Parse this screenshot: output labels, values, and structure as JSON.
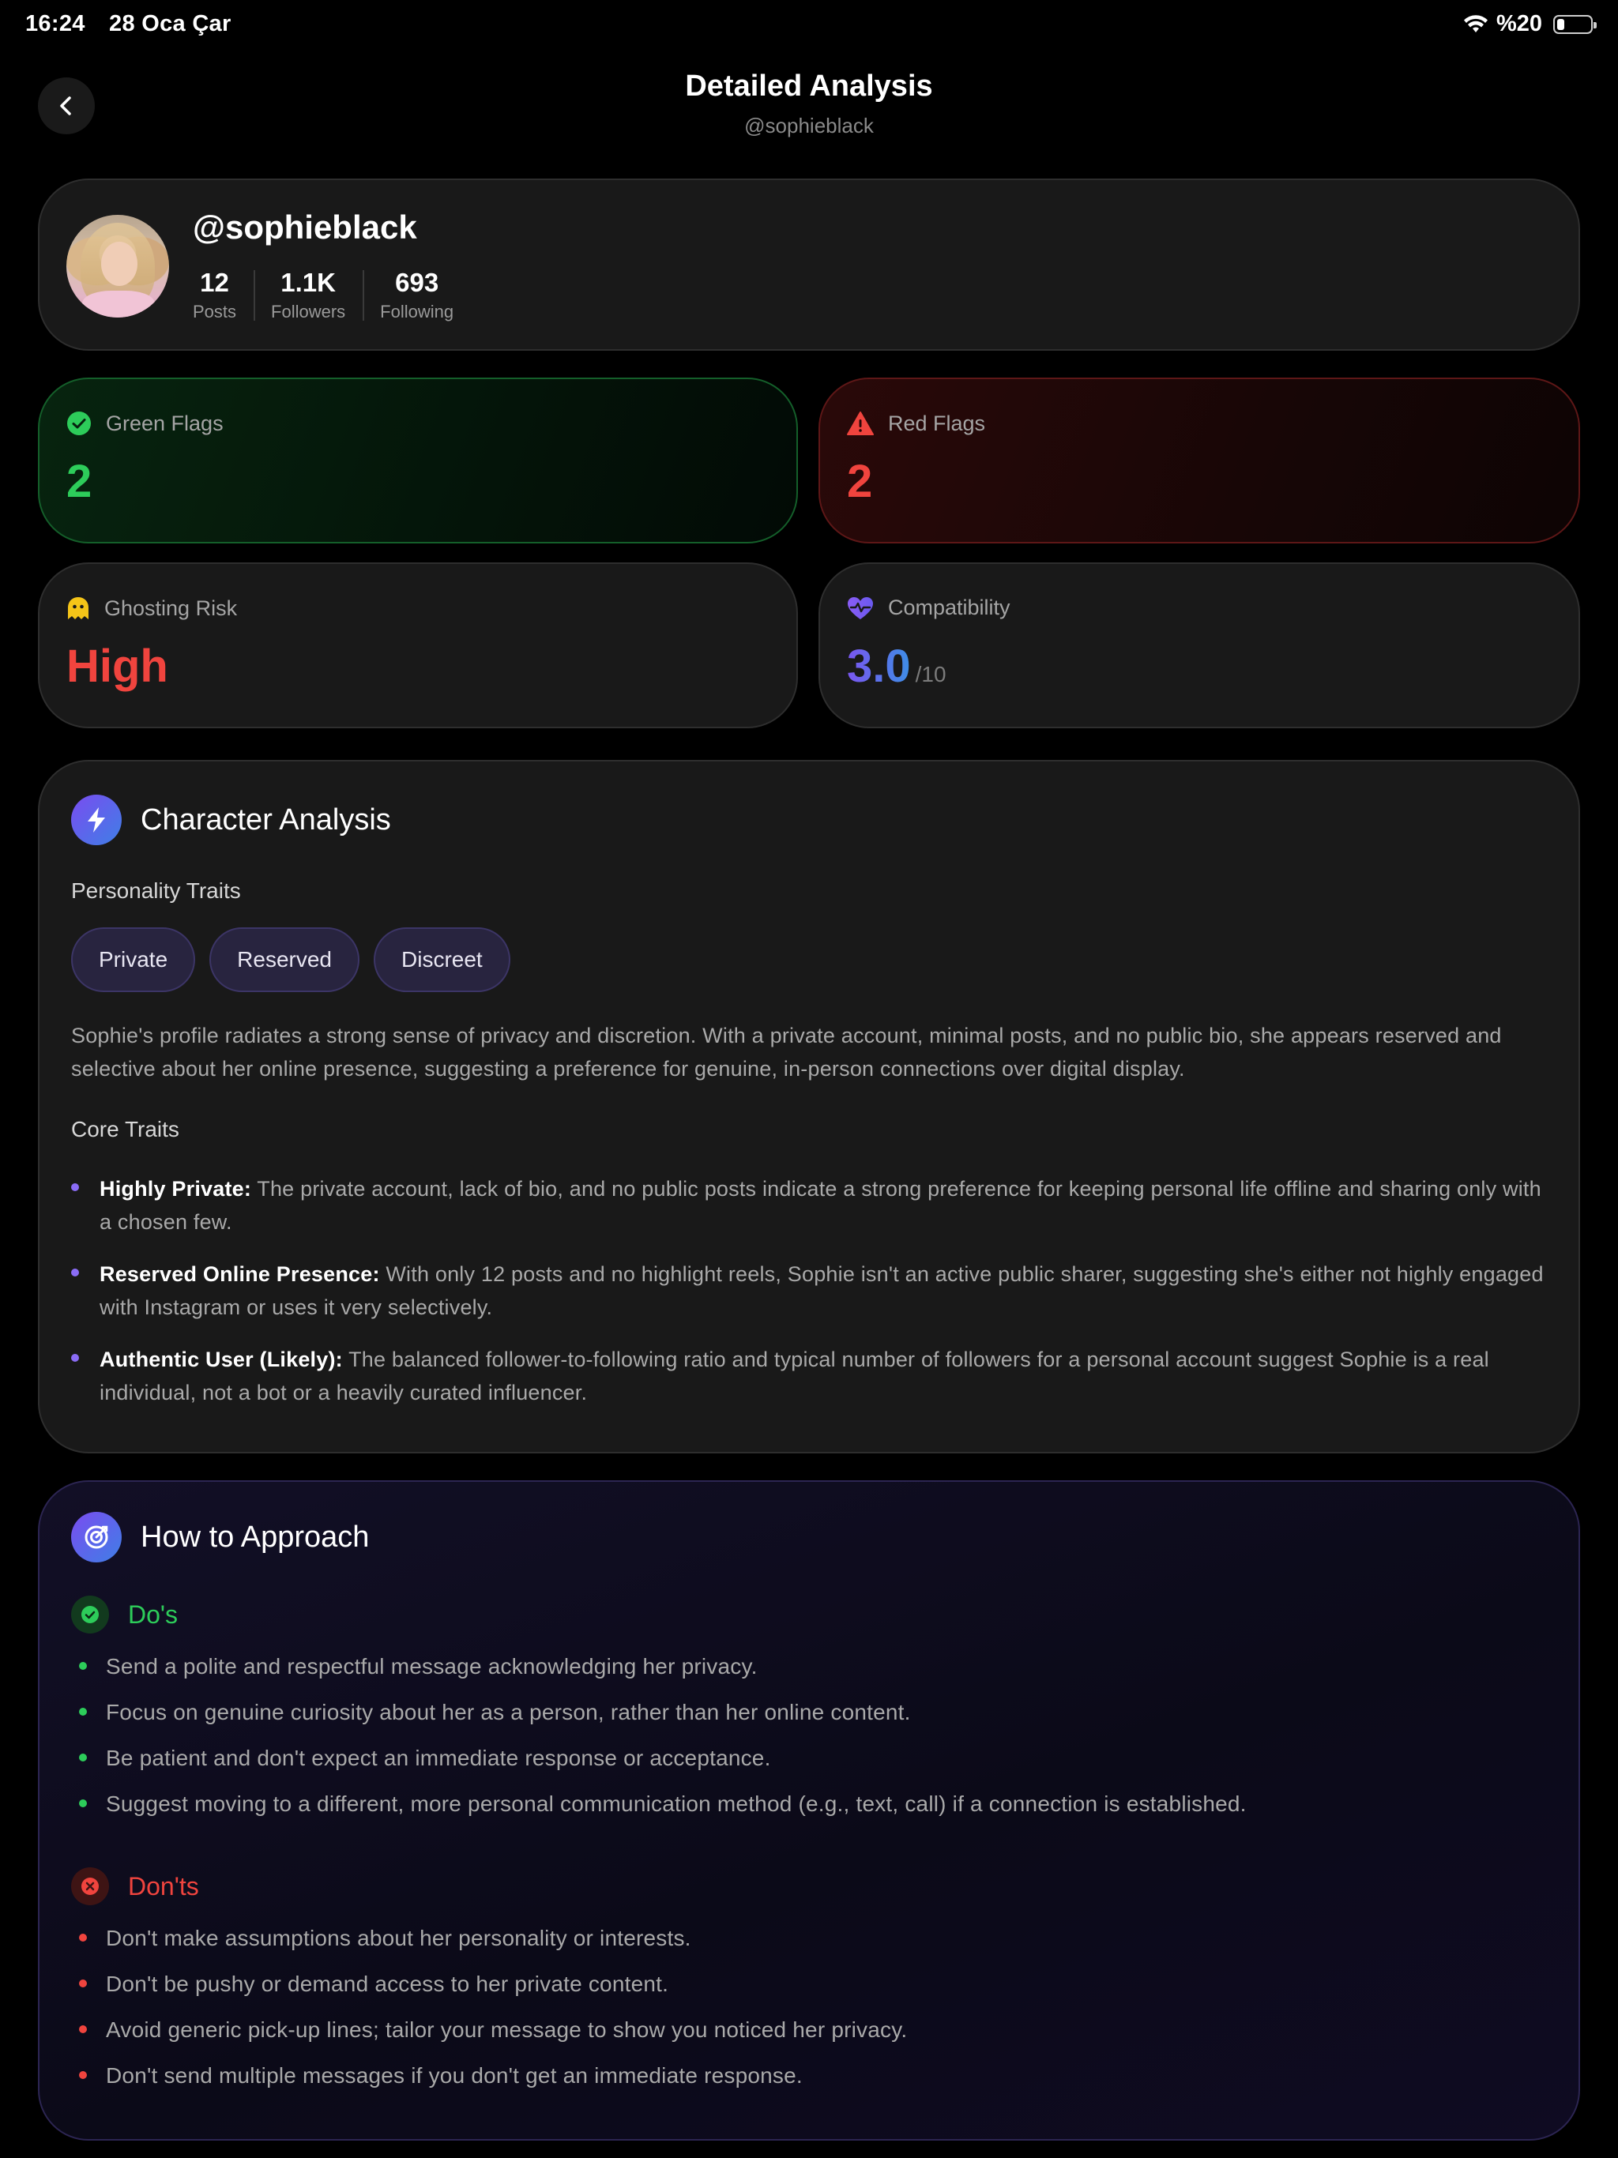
{
  "status": {
    "time": "16:24",
    "date": "28 Oca Çar",
    "battery": "%20",
    "battery_level": 0.2
  },
  "header": {
    "title": "Detailed Analysis",
    "subtitle": "@sophieblack"
  },
  "profile": {
    "username": "@sophieblack",
    "stats": [
      {
        "value": "12",
        "label": "Posts"
      },
      {
        "value": "1.1K",
        "label": "Followers"
      },
      {
        "value": "693",
        "label": "Following"
      }
    ]
  },
  "metrics": {
    "green_flags": {
      "label": "Green Flags",
      "value": "2",
      "color": "#2dcc5a"
    },
    "red_flags": {
      "label": "Red Flags",
      "value": "2",
      "color": "#f0443e"
    },
    "ghosting_risk": {
      "label": "Ghosting Risk",
      "value": "High",
      "color": "#f0443e"
    },
    "compatibility": {
      "label": "Compatibility",
      "value": "3.0",
      "suffix": "/10"
    }
  },
  "character": {
    "title": "Character Analysis",
    "personality_label": "Personality Traits",
    "traits": [
      "Private",
      "Reserved",
      "Discreet"
    ],
    "summary": "Sophie's profile radiates a strong sense of privacy and discretion. With a private account, minimal posts, and no public bio, she appears reserved and selective about her online presence, suggesting a preference for genuine, in-person connections over digital display.",
    "core_label": "Core Traits",
    "core_traits": [
      {
        "title": "Highly Private:",
        "text": " The private account, lack of bio, and no public posts indicate a strong preference for keeping personal life offline and sharing only with a chosen few."
      },
      {
        "title": "Reserved Online Presence:",
        "text": " With only 12 posts and no highlight reels, Sophie isn't an active public sharer, suggesting she's either not highly engaged with Instagram or uses it very selectively."
      },
      {
        "title": "Authentic User (Likely):",
        "text": " The balanced follower-to-following ratio and typical number of followers for a personal account suggest Sophie is a real individual, not a bot or a heavily curated influencer."
      }
    ]
  },
  "approach": {
    "title": "How to Approach",
    "dos_label": "Do's",
    "dos": [
      "Send a polite and respectful message acknowledging her privacy.",
      "Focus on genuine curiosity about her as a person, rather than her online content.",
      "Be patient and don't expect an immediate response or acceptance.",
      "Suggest moving to a different, more personal communication method (e.g., text, call) if a connection is established."
    ],
    "donts_label": "Don'ts",
    "donts": [
      "Don't make assumptions about her personality or interests.",
      "Don't be pushy or demand access to her private content.",
      "Avoid generic pick-up lines; tailor your message to show you noticed her privacy.",
      "Don't send multiple messages if you don't get an immediate response."
    ]
  },
  "colors": {
    "accent_purple": "#7a4cf0",
    "accent_blue": "#3f7fe6",
    "green": "#2dcc5a",
    "red": "#f0443e",
    "yellow": "#f5c518"
  }
}
